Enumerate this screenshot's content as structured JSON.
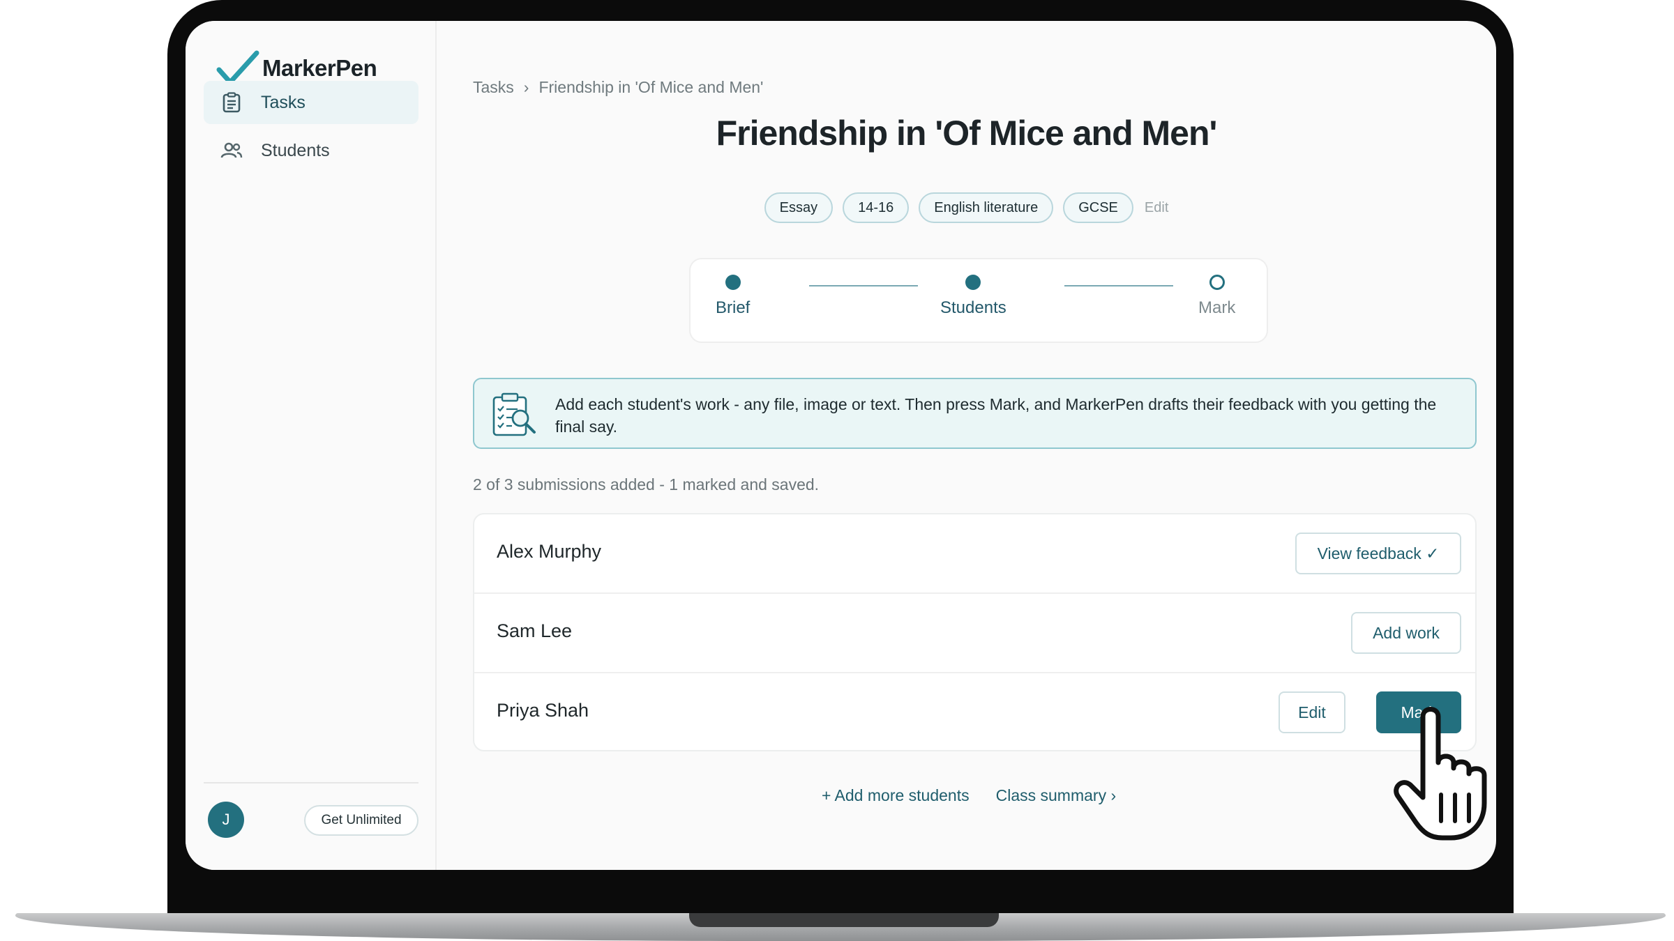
{
  "brand": {
    "name": "MarkerPen",
    "accent": "#23707f"
  },
  "sidebar": {
    "items": [
      {
        "label": "Tasks",
        "icon": "clipboard-icon",
        "active": true
      },
      {
        "label": "Students",
        "icon": "people-icon",
        "active": false
      }
    ],
    "avatar_initial": "J",
    "upgrade_label": "Get Unlimited"
  },
  "breadcrumb": {
    "root": "Tasks",
    "separator": "›",
    "current": "Friendship in 'Of Mice and Men'"
  },
  "task": {
    "title": "Friendship in 'Of Mice and Men'",
    "tags": [
      "Essay",
      "14-16",
      "English literature",
      "GCSE"
    ],
    "edit_label": "Edit"
  },
  "stepper": {
    "steps": [
      {
        "label": "Brief",
        "state": "done"
      },
      {
        "label": "Students",
        "state": "current"
      },
      {
        "label": "Mark",
        "state": "pending"
      }
    ]
  },
  "info_banner": {
    "icon": "clipboard-search-icon",
    "text": "Add each student's work - any file, image or text. Then press Mark, and MarkerPen drafts their feedback with you getting the final say."
  },
  "progress_text": "2 of 3 submissions added - 1 marked and saved.",
  "students": [
    {
      "name": "Alex Murphy",
      "actions": [
        "View feedback ✓"
      ]
    },
    {
      "name": "Sam Lee",
      "actions": [
        "Add work"
      ]
    },
    {
      "name": "Priya Shah",
      "actions": [
        "Edit",
        "Mark"
      ]
    }
  ],
  "footer": {
    "add_more": "+ Add more students",
    "summary": "Class summary ›"
  },
  "cursor": "hand-pointer-icon"
}
